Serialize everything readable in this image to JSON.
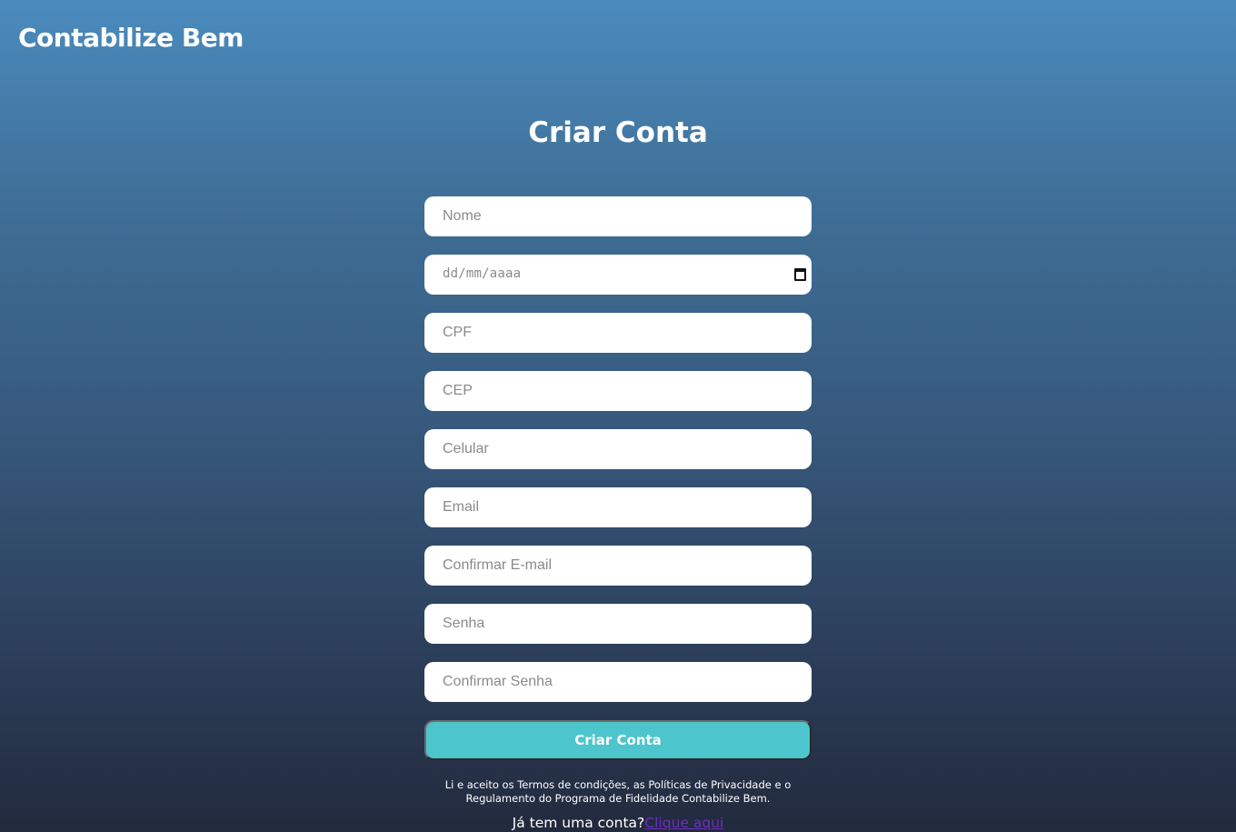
{
  "header": {
    "brand": "Contabilize Bem"
  },
  "main": {
    "title": "Criar Conta"
  },
  "form": {
    "name_placeholder": "Nome",
    "birthdate_placeholder": "dd/mm/aaaa",
    "cpf_placeholder": "CPF",
    "cep_placeholder": "CEP",
    "phone_placeholder": "Celular",
    "email_placeholder": "Email",
    "confirm_email_placeholder": "Confirmar E-mail",
    "password_placeholder": "Senha",
    "confirm_password_placeholder": "Confirmar Senha",
    "submit_label": "Criar Conta"
  },
  "footer": {
    "terms_text": "Li e aceito os Termos de condições, as Políticas de Privacidade e o Regulamento do Programa de Fidelidade Contabilize Bem.",
    "login_prompt": "Já tem uma conta?",
    "login_link": "Clique aqui"
  },
  "colors": {
    "background_top": "#4a8bbd",
    "background_bottom": "#222a3d",
    "button": "#4cc5cc",
    "link": "#6b2fbf"
  },
  "icons": {
    "date_picker": "calendar-icon"
  }
}
